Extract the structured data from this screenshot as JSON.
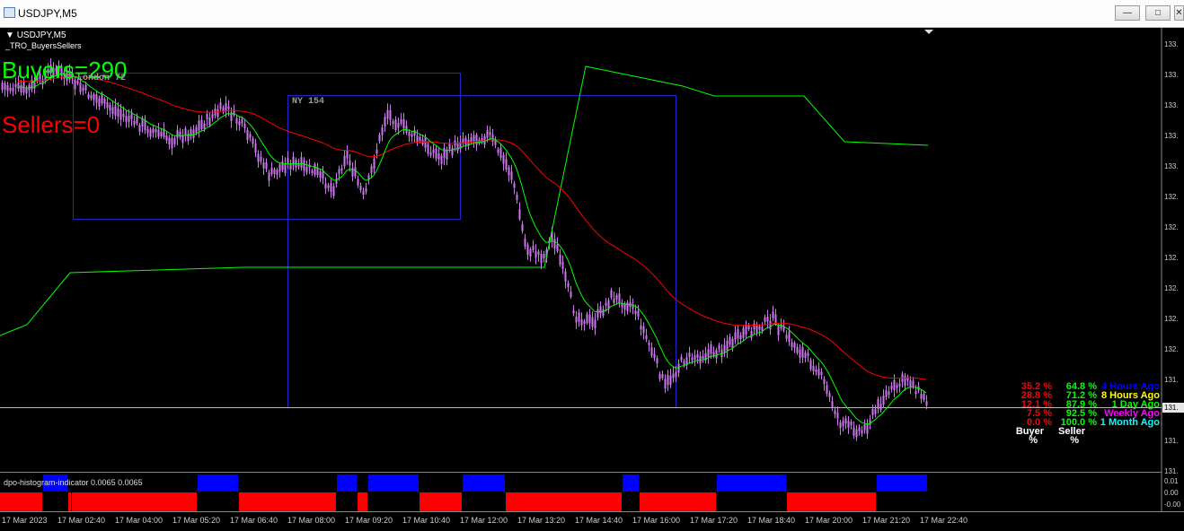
{
  "window": {
    "title": "USDJPY,M5",
    "minimize_glyph": "—",
    "maximize_glyph": "□",
    "close_glyph": "✕"
  },
  "chart": {
    "symbol_label": "USDJPY,M5",
    "indicator_name": "_TRO_BuyersSellers",
    "buyers_text": "Buyers=290",
    "sellers_text": "Sellers=0",
    "sessions": [
      {
        "label": "London 72"
      },
      {
        "label": "NY 154"
      }
    ],
    "histogram_label": "dpo-histogram-indicator 0.0065 0.0065",
    "price_labels": [
      "133.",
      "133.",
      "133.",
      "133.",
      "133.",
      "132.",
      "132.",
      "132.",
      "132.",
      "132.",
      "132.",
      "131.",
      "131.",
      "131.",
      "131."
    ],
    "current_price_label": "131.",
    "histogram_scale": [
      "0.01",
      "0.00",
      "-0.00"
    ],
    "time_labels": [
      "17 Mar 2023",
      "17 Mar 02:40",
      "17 Mar 04:00",
      "17 Mar 05:20",
      "17 Mar 06:40",
      "17 Mar 08:00",
      "17 Mar 09:20",
      "17 Mar 10:40",
      "17 Mar 12:00",
      "17 Mar 13:20",
      "17 Mar 14:40",
      "17 Mar 16:00",
      "17 Mar 17:20",
      "17 Mar 18:40",
      "17 Mar 20:00",
      "17 Mar 21:20",
      "17 Mar 22:40"
    ],
    "stats": [
      {
        "buyer": "35.2 %",
        "seller": "64.8 %",
        "period": "4 Hours Ago",
        "period_color": "#0000ff"
      },
      {
        "buyer": "28.8 %",
        "seller": "71.2 %",
        "period": "8 Hours Ago",
        "period_color": "#ffff00"
      },
      {
        "buyer": "12.1 %",
        "seller": "87.9 %",
        "period": "1 Day Ago",
        "period_color": "#00ff00"
      },
      {
        "buyer": "7.5 %",
        "seller": "92.5 %",
        "period": "Weekly Ago",
        "period_color": "#ff00ff"
      },
      {
        "buyer": "0.0 %",
        "seller": "100.0 %",
        "period": "1 Month Ago",
        "period_color": "#00ffff"
      }
    ],
    "stats_header": {
      "buyer": "Buyer",
      "seller": "Seller",
      "unit": "%"
    },
    "colors": {
      "candles": "#cc77ee",
      "fast_ma": "#00ff00",
      "slow_ma": "#ff0000",
      "session_box": "#2222cc",
      "buyer_pct": "#ff0000",
      "seller_pct": "#00ff00",
      "hist_up": "#0000ff",
      "hist_down": "#ff0000"
    }
  }
}
